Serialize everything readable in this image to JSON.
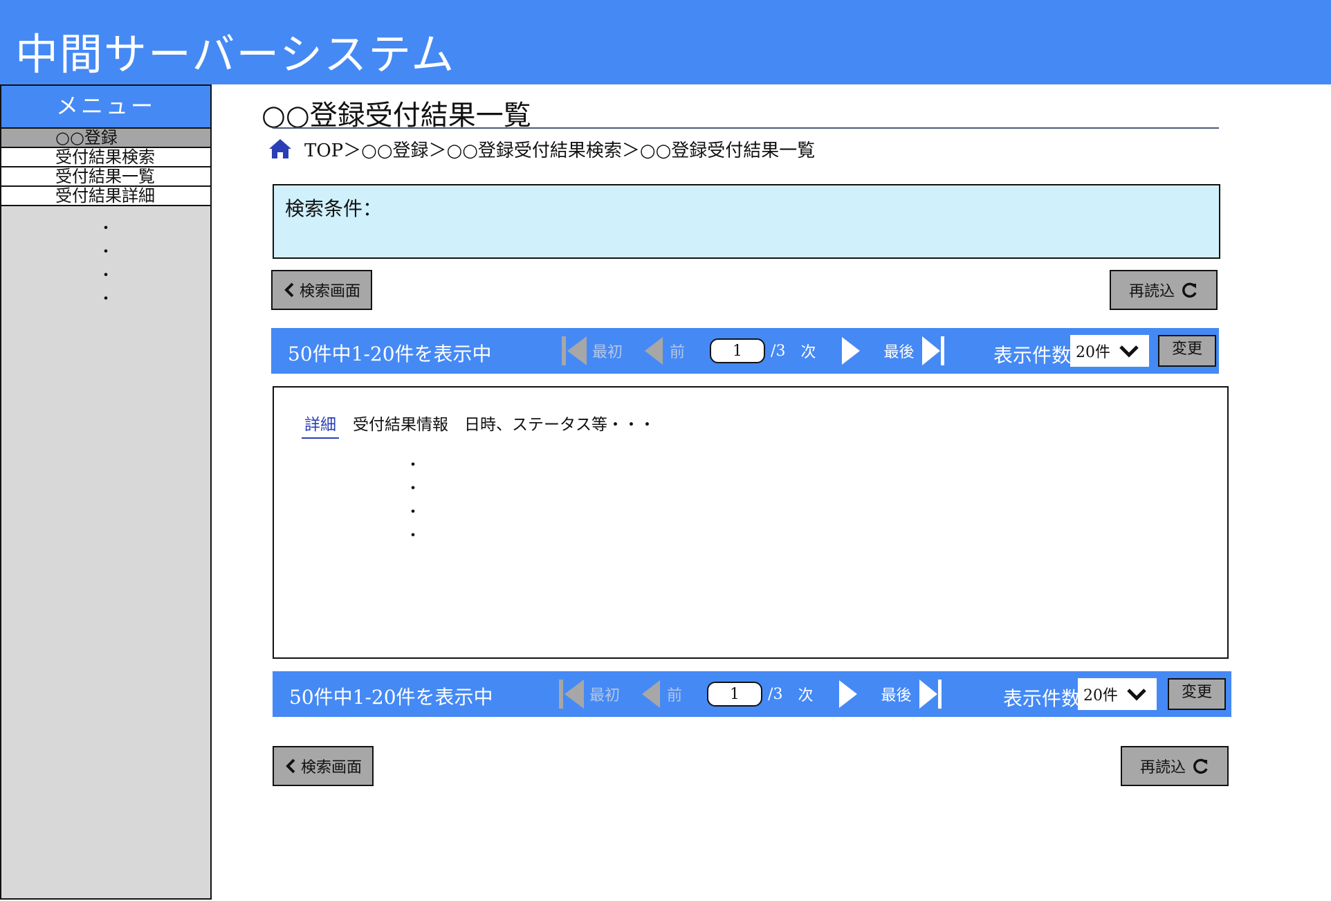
{
  "app": {
    "title": "中間サーバーシステム"
  },
  "sidebar": {
    "title": "メニュー",
    "items": [
      {
        "label": "○○登録",
        "active": true
      },
      {
        "label": "受付結果検索"
      },
      {
        "label": "受付結果一覧"
      },
      {
        "label": "受付結果詳細"
      }
    ],
    "more": "・\n・\n・\n・"
  },
  "page": {
    "title": "○○登録受付結果一覧",
    "breadcrumb": "TOP＞○○登録＞○○登録受付結果検索＞○○登録受付結果一覧"
  },
  "search": {
    "label": "検索条件："
  },
  "buttons": {
    "back_label": "検索画面",
    "reload_label": "再読込"
  },
  "pager": {
    "count_text": "50件中1-20件を表示中",
    "first_label": "最初",
    "prev_label": "前",
    "page_value": "1",
    "total_pages": "/3",
    "next_label": "次",
    "last_label": "最後",
    "per_page_label": "表示件数",
    "per_page_value": "20件",
    "change_label": "変更"
  },
  "results": {
    "detail_link": "詳細",
    "row_text": "受付結果情報　日時、ステータス等・・・",
    "more": "・\n・\n・\n・"
  },
  "colors": {
    "header": "#4589f5",
    "sidebar": "#d8d8d8",
    "search_bg": "#d0f0fc",
    "button": "#a7a7a7",
    "link": "#2a3fb6"
  }
}
